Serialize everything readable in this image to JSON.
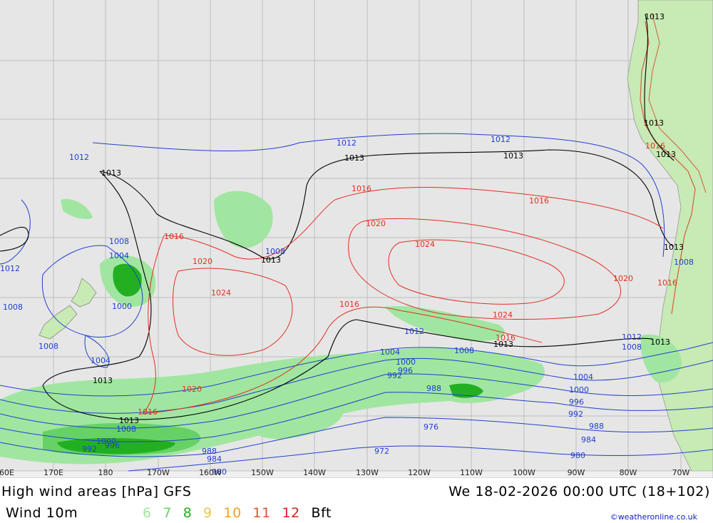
{
  "header": {
    "title_left": "High wind areas [hPa] GFS",
    "title_right": "We 18-02-2026 00:00 UTC (18+102)"
  },
  "legend": {
    "wind_label": "Wind 10m",
    "scale": [
      {
        "value": "6",
        "color": "#a0e6a0"
      },
      {
        "value": "7",
        "color": "#66d266"
      },
      {
        "value": "8",
        "color": "#22b022"
      },
      {
        "value": "9",
        "color": "#e6c84a"
      },
      {
        "value": "10",
        "color": "#f0a020"
      },
      {
        "value": "11",
        "color": "#e05030"
      },
      {
        "value": "12",
        "color": "#d02020"
      }
    ],
    "unit": "Bft",
    "credit": "©weatheronline.co.uk"
  },
  "map": {
    "ocean_color": "#e6e6e6",
    "land_color": "#c8eab4",
    "longitude_labels": [
      "160E",
      "170E",
      "180",
      "170W",
      "160W",
      "150W",
      "140W",
      "130W",
      "120W",
      "110W",
      "100W",
      "90W",
      "80W",
      "70W"
    ],
    "isobar_labels": {
      "black": [
        "1013",
        "1013",
        "1013",
        "1013",
        "1013",
        "1013",
        "1013",
        "1013",
        "1013",
        "1013",
        "1013",
        "1013",
        "1013"
      ],
      "red": [
        "1016",
        "1016",
        "1016",
        "1016",
        "1016",
        "1016",
        "1016",
        "1020",
        "1020",
        "1020",
        "1020",
        "1024",
        "1024",
        "1024",
        "1016"
      ],
      "blue": [
        "1012",
        "1012",
        "1012",
        "1012",
        "1012",
        "1012",
        "1008",
        "1008",
        "1008",
        "1008",
        "1008",
        "1004",
        "1000",
        "1008",
        "1008",
        "1004",
        "1004",
        "1000",
        "996",
        "992",
        "988",
        "1004",
        "1000",
        "996",
        "992",
        "988",
        "984",
        "980",
        "976",
        "972",
        "988",
        "984",
        "980",
        "1000",
        "1008",
        "996",
        "992"
      ]
    }
  }
}
